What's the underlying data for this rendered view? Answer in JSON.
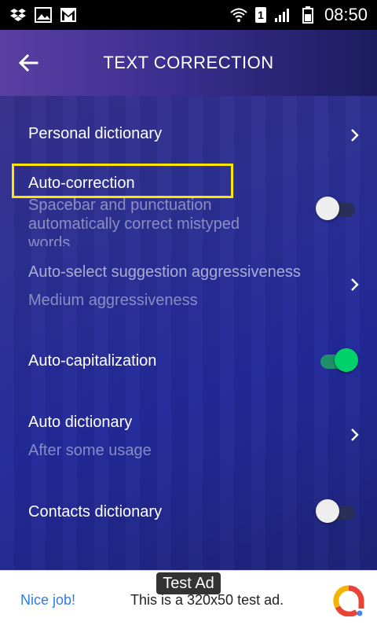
{
  "statusbar": {
    "icons_left": [
      "dropbox-icon",
      "image-icon",
      "gmail-icon"
    ],
    "icons_right": [
      "wifi-icon",
      "sim-icon",
      "signal-icon",
      "battery-icon"
    ],
    "sim_badge": "1",
    "time": "08:50"
  },
  "appbar": {
    "title": "TEXT CORRECTION",
    "back_icon": "arrow-left-icon"
  },
  "settings": {
    "personal_dictionary": {
      "title": "Personal dictionary"
    },
    "auto_correction": {
      "title": "Auto-correction",
      "summary": "Spacebar and punctuation automatically correct mistyped words",
      "toggle": "off"
    },
    "auto_select": {
      "title": "Auto-select suggestion aggressiveness",
      "summary": "Medium aggressiveness"
    },
    "auto_capitalization": {
      "title": "Auto-capitalization",
      "toggle": "on"
    },
    "auto_dictionary": {
      "title": "Auto dictionary",
      "summary": "After some usage"
    },
    "contacts_dictionary": {
      "title": "Contacts dictionary",
      "toggle": "off"
    }
  },
  "ad": {
    "label": "Test Ad",
    "cta": "Nice job!",
    "text": "This is a 320x50 test ad."
  },
  "colors": {
    "highlight": "#ffe600",
    "toggle_on": "#00d26a",
    "ad_link": "#2f7de1"
  }
}
